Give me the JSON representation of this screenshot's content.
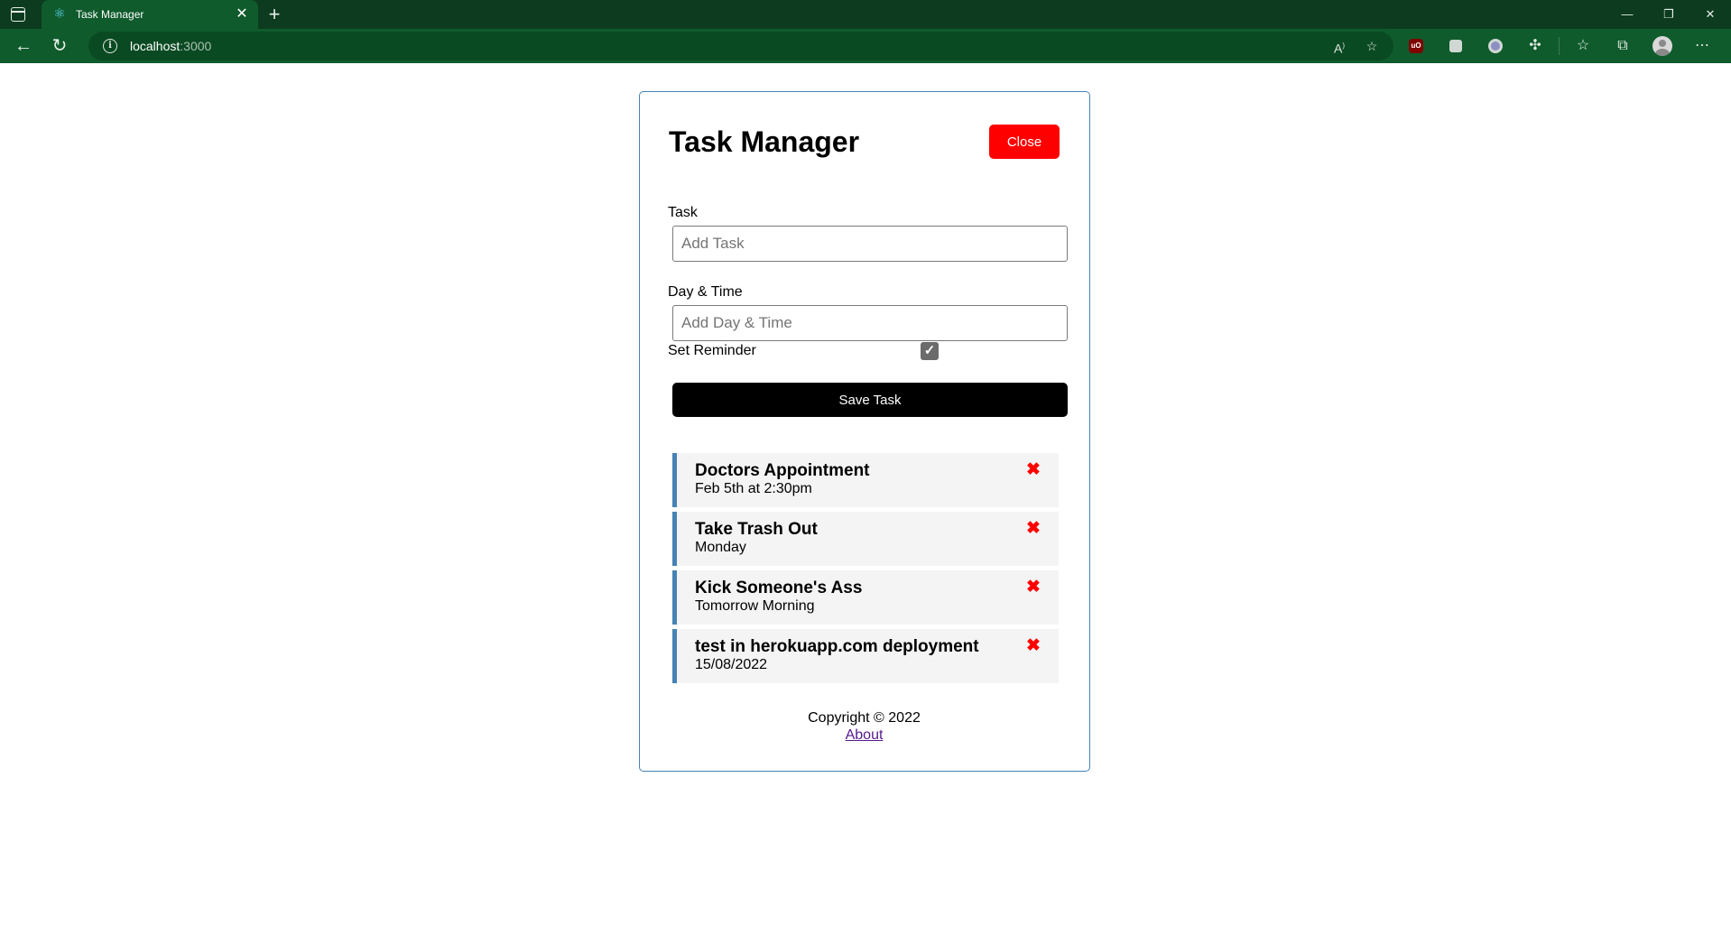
{
  "browser": {
    "tab_title": "Task Manager",
    "url_host": "localhost",
    "url_port": ":3000",
    "window_controls": [
      "—",
      "❐",
      "✕"
    ]
  },
  "app": {
    "title": "Task Manager",
    "close_button": "Close"
  },
  "form": {
    "task_label": "Task",
    "task_placeholder": "Add Task",
    "daytime_label": "Day & Time",
    "daytime_placeholder": "Add Day & Time",
    "reminder_label": "Set Reminder",
    "reminder_checked": true,
    "save_button": "Save Task"
  },
  "tasks": [
    {
      "title": "Doctors Appointment",
      "day": "Feb 5th at 2:30pm",
      "reminder": true
    },
    {
      "title": "Take Trash Out",
      "day": "Monday",
      "reminder": true
    },
    {
      "title": "Kick Someone's Ass",
      "day": "Tomorrow Morning",
      "reminder": true
    },
    {
      "title": "test in herokuapp.com deployment",
      "day": "15/08/2022",
      "reminder": true
    }
  ],
  "footer": {
    "copyright": "Copyright © 2022",
    "about_link": "About"
  },
  "colors": {
    "accent": "#4682b4",
    "close_button": "#ff0000",
    "save_button": "#000000",
    "delete_icon": "#ff0000",
    "browser_frame": "#0f5b2c"
  },
  "icons": {
    "delete": "times-icon",
    "checkbox": "checkmark-icon"
  }
}
